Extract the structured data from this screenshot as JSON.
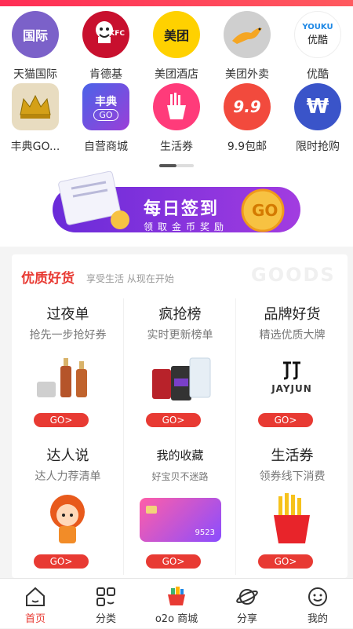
{
  "colors": {
    "accent": "#e83a33",
    "tab_active": "#e83a33"
  },
  "shortcuts_row1": [
    {
      "label": "天猫国际",
      "icon": "tmall-global-icon",
      "text": "国际"
    },
    {
      "label": "肯德基",
      "icon": "kfc-icon",
      "text": "KFC"
    },
    {
      "label": "美团酒店",
      "icon": "meituan-hotel-icon",
      "text": "美团"
    },
    {
      "label": "美团外卖",
      "icon": "meituan-delivery-icon",
      "text": ""
    },
    {
      "label": "优酷",
      "icon": "youku-icon",
      "text": "YOUKU",
      "text2": "优酷"
    }
  ],
  "shortcuts_row2": [
    {
      "label": "丰典GO...",
      "icon": "crown-icon"
    },
    {
      "label": "自营商城",
      "icon": "fengdian-go-icon",
      "text": "丰典",
      "text2": "GO"
    },
    {
      "label": "生活券",
      "icon": "fries-icon"
    },
    {
      "label": "9.9包邮",
      "icon": "nine-nine-icon",
      "text": "9.9"
    },
    {
      "label": "限时抢购",
      "icon": "won-coin-icon",
      "text": "₩"
    }
  ],
  "banner": {
    "title": "每日签到",
    "subtitle": "领取金币奖励",
    "go": "GO"
  },
  "goods": {
    "title": "优质好货",
    "subtitle": "享受生活 从现在开始",
    "watermark": "GOODS",
    "cards": [
      {
        "title": "过夜单",
        "desc": "抢先一步抢好券",
        "go": "GO>",
        "image": "skincare-bottles-image"
      },
      {
        "title": "疯抢榜",
        "desc": "实时更新榜单",
        "go": "GO>",
        "image": "protein-tubs-image"
      },
      {
        "title": "品牌好货",
        "desc": "精选优质大牌",
        "go": "GO>",
        "image": "jayjun-logo-image",
        "brand": "JAYJUN"
      },
      {
        "title": "达人说",
        "desc": "达人力荐清单",
        "go": "GO>",
        "image": "girl-avatar-image"
      },
      {
        "title": "我的收藏",
        "desc": "好宝贝不迷路",
        "go": "GO>",
        "image": "card-image",
        "card_no": "9523"
      },
      {
        "title": "生活券",
        "desc": "领券线下消费",
        "go": "GO>",
        "image": "fries-image"
      }
    ]
  },
  "tabs": [
    {
      "label": "首页",
      "icon": "home-icon",
      "active": true
    },
    {
      "label": "分类",
      "icon": "category-icon",
      "active": false
    },
    {
      "label": "o2o 商城",
      "icon": "shopping-basket-icon",
      "active": false
    },
    {
      "label": "分享",
      "icon": "planet-icon",
      "active": false
    },
    {
      "label": "我的",
      "icon": "smiley-icon",
      "active": false
    }
  ]
}
